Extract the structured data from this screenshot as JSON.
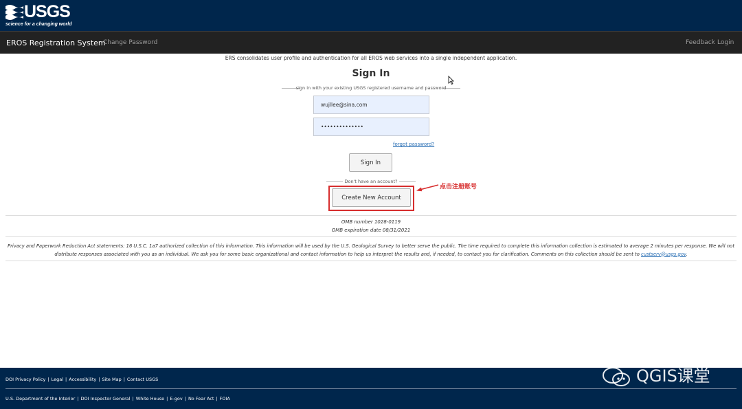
{
  "header": {
    "logo_text": "USGS",
    "tagline": "science for a changing world"
  },
  "nav": {
    "brand": "EROS Registration System",
    "change_password": "Change Password",
    "feedback": "Feedback",
    "login": "Login"
  },
  "main": {
    "intro": "ERS consolidates user profile and authentication for all EROS web services into a single independent application.",
    "title": "Sign In",
    "subtitle": "sign in with your existing USGS registered username and password",
    "username_value": "wujllee@sina.com",
    "password_value": "••••••••••••••",
    "forgot": "forgot password?",
    "signin_button": "Sign In",
    "no_account": "Don't have an account?",
    "create_button": "Create New Account",
    "annotation": "点击注册账号",
    "omb_number": "OMB number 1028-0119",
    "omb_expiration": "OMB expiration date 08/31/2021",
    "privacy_text": "Privacy and Paperwork Reduction Act statements: 16 U.S.C. 1a7 authorized collection of this information. This information will be used by the U.S. Geological Survey to better serve the public. The time required to complete this information collection is estimated to average 2 minutes per response. We will not distribute responses associated with you as an individual. We ask you for some basic organizational and contact information to help us interpret the results and, if needed, to contact you for clarification. Comments on this collection should be sent to ",
    "privacy_email": "custserv@usgs.gov",
    "privacy_end": "."
  },
  "footer": {
    "row1": [
      "DOI Privacy Policy",
      "Legal",
      "Accessibility",
      "Site Map",
      "Contact USGS"
    ],
    "row2": [
      "U.S. Department of the Interior",
      "DOI Inspector General",
      "White House",
      "E-gov",
      "No Fear Act",
      "FOIA"
    ],
    "watermark": "QGIS课堂"
  },
  "colors": {
    "usgs_blue": "#00264c",
    "nav_dark": "#222222",
    "highlight_red": "#d72d2d",
    "input_fill": "#e8f0fe"
  }
}
